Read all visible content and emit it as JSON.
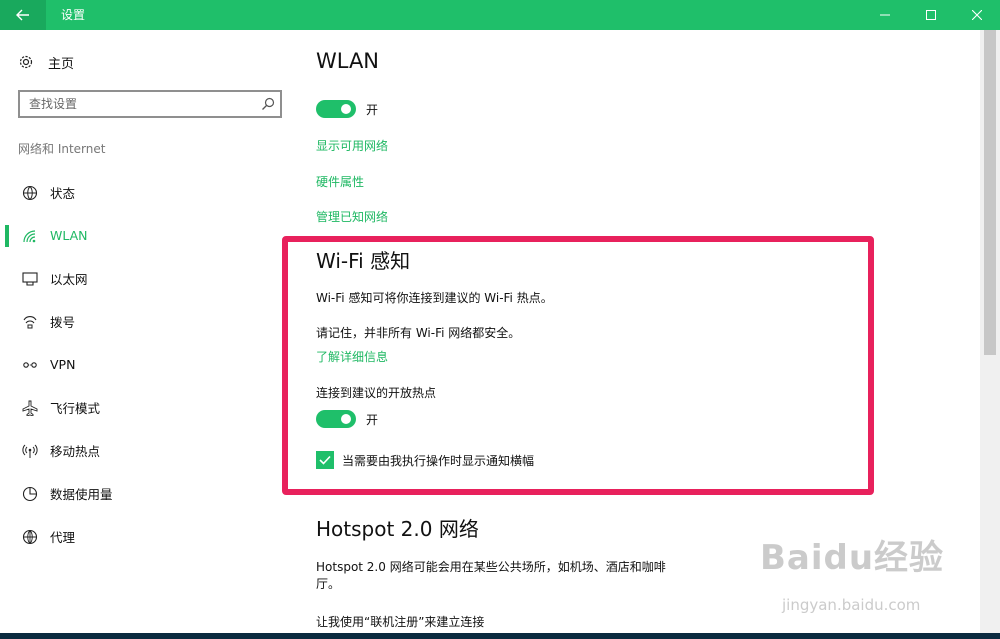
{
  "titlebar": {
    "title": "设置",
    "back_icon": "arrow-left-icon",
    "controls": [
      "minimize-icon",
      "maximize-icon",
      "close-icon"
    ]
  },
  "sidebar": {
    "home_label": "主页",
    "search_placeholder": "查找设置",
    "section_label": "网络和 Internet",
    "items": [
      {
        "label": "状态",
        "icon": "globe-status-icon",
        "active": false
      },
      {
        "label": "WLAN",
        "icon": "wifi-icon",
        "active": true
      },
      {
        "label": "以太网",
        "icon": "ethernet-icon",
        "active": false
      },
      {
        "label": "拨号",
        "icon": "dialup-icon",
        "active": false
      },
      {
        "label": "VPN",
        "icon": "vpn-icon",
        "active": false
      },
      {
        "label": "飞行模式",
        "icon": "airplane-icon",
        "active": false
      },
      {
        "label": "移动热点",
        "icon": "hotspot-icon",
        "active": false
      },
      {
        "label": "数据使用量",
        "icon": "data-usage-icon",
        "active": false
      },
      {
        "label": "代理",
        "icon": "globe-icon",
        "active": false
      }
    ]
  },
  "main": {
    "wlan_title": "WLAN",
    "wlan_toggle_label": "开",
    "wlan_toggle_on": true,
    "links": [
      "显示可用网络",
      "硬件属性",
      "管理已知网络"
    ],
    "wifi_sense": {
      "title": "Wi-Fi 感知",
      "desc1": "Wi-Fi 感知可将你连接到建议的 Wi-Fi 热点。",
      "desc2": "请记住，并非所有 Wi-Fi 网络都安全。",
      "learn_more": "了解详细信息",
      "connect_label": "连接到建议的开放热点",
      "toggle_label": "开",
      "toggle_on": true,
      "checkbox_label": "当需要由我执行操作时显示通知横幅",
      "checkbox_checked": true
    },
    "hotspot": {
      "title": "Hotspot 2.0 网络",
      "desc_line1": "Hotspot 2.0 网络可能会用在某些公共场所，如机场、酒店和咖啡",
      "desc_line2": "厅。",
      "option": "让我使用“联机注册”来建立连接"
    }
  },
  "watermark": {
    "logo": "Baidu经验",
    "sub": "jingyan.baidu.com"
  },
  "colors": {
    "accent": "#1fbf6a",
    "highlight": "#e8215c"
  }
}
